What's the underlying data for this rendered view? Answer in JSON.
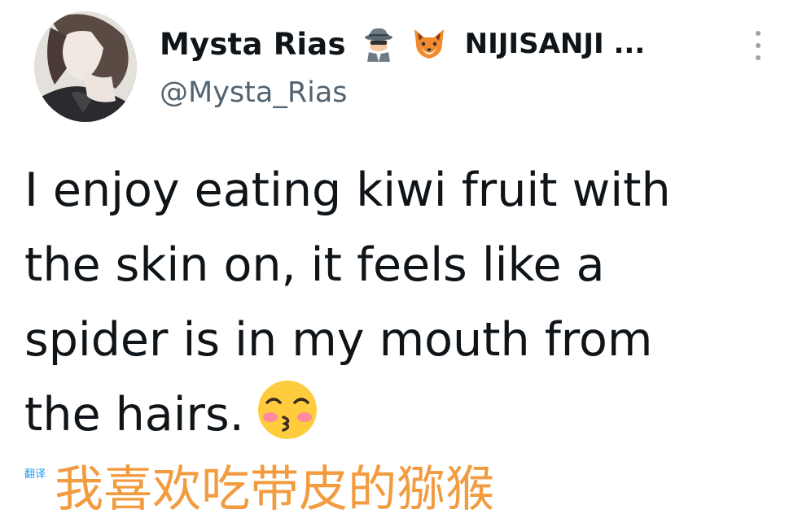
{
  "user": {
    "display_name": "Mysta Rias",
    "org_name": "NIJISANJI ...",
    "handle": "@Mysta_Rias",
    "name_icons": [
      "detective-icon",
      "fox-icon"
    ]
  },
  "tweet": {
    "lines": [
      "I enjoy eating kiwi fruit with",
      "the skin on, it feels like a",
      "spider is in my mouth from",
      "the hairs."
    ],
    "end_emoji": "kissing-face-icon"
  },
  "translation": {
    "label": "翻译",
    "text": "我喜欢吃带皮的猕猴"
  },
  "colors": {
    "text": "#0f1419",
    "handle": "#536471",
    "translation": "#f29b3f",
    "more_dots": "#9aa3ab"
  }
}
